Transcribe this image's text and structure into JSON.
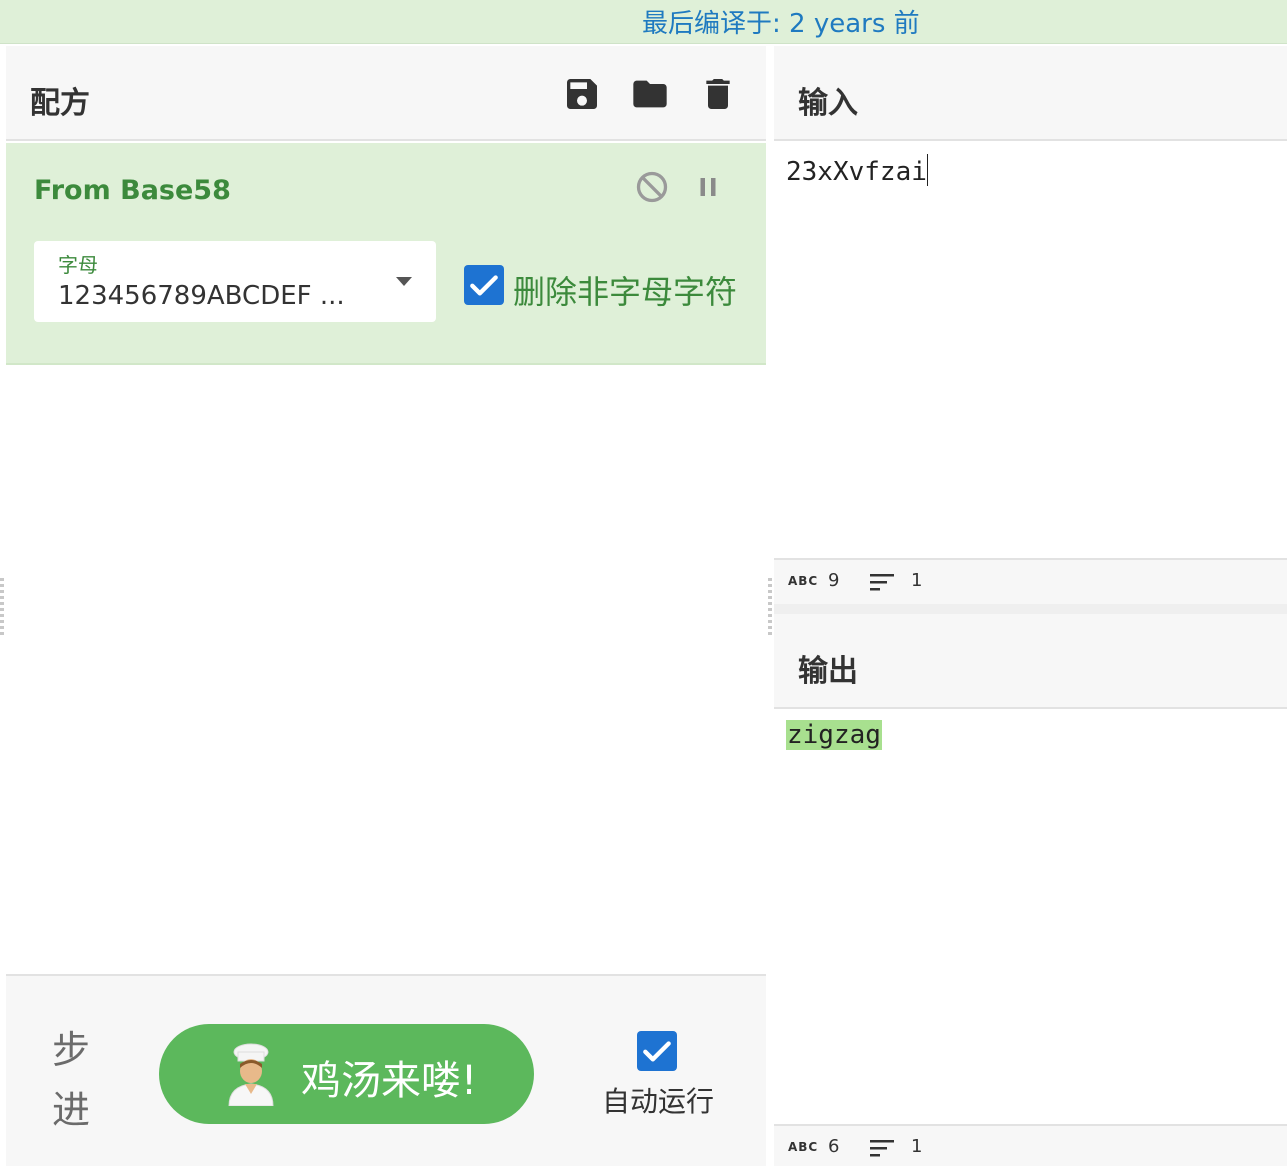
{
  "banner": {
    "text": "最后编译于: 2 years 前"
  },
  "recipe": {
    "title": "配方",
    "toolbar": {
      "save_icon": "save-icon",
      "load_icon": "folder-icon",
      "clear_icon": "trash-icon"
    },
    "operation": {
      "name": "From Base58",
      "alphabet_label": "字母",
      "alphabet_value": "123456789ABCDEF ...",
      "remove_non_alpha_label": "删除非字母字符",
      "remove_non_alpha_checked": true
    },
    "controls": {
      "step_label": "步进",
      "bake_label": "鸡汤来喽!",
      "autobake_label": "自动运行",
      "autobake_checked": true
    }
  },
  "input": {
    "title": "输入",
    "text": "23xXvfzai",
    "stats": {
      "length": "9",
      "lines": "1"
    }
  },
  "output": {
    "title": "输出",
    "text": "zigzag",
    "stats": {
      "length": "6",
      "lines": "1"
    }
  },
  "colors": {
    "accent_green": "#5cb85c",
    "op_background": "#dff0d8",
    "checkbox_blue": "#1e73d2",
    "banner_link": "#1f7ac0",
    "output_highlight": "#a8e08f"
  }
}
